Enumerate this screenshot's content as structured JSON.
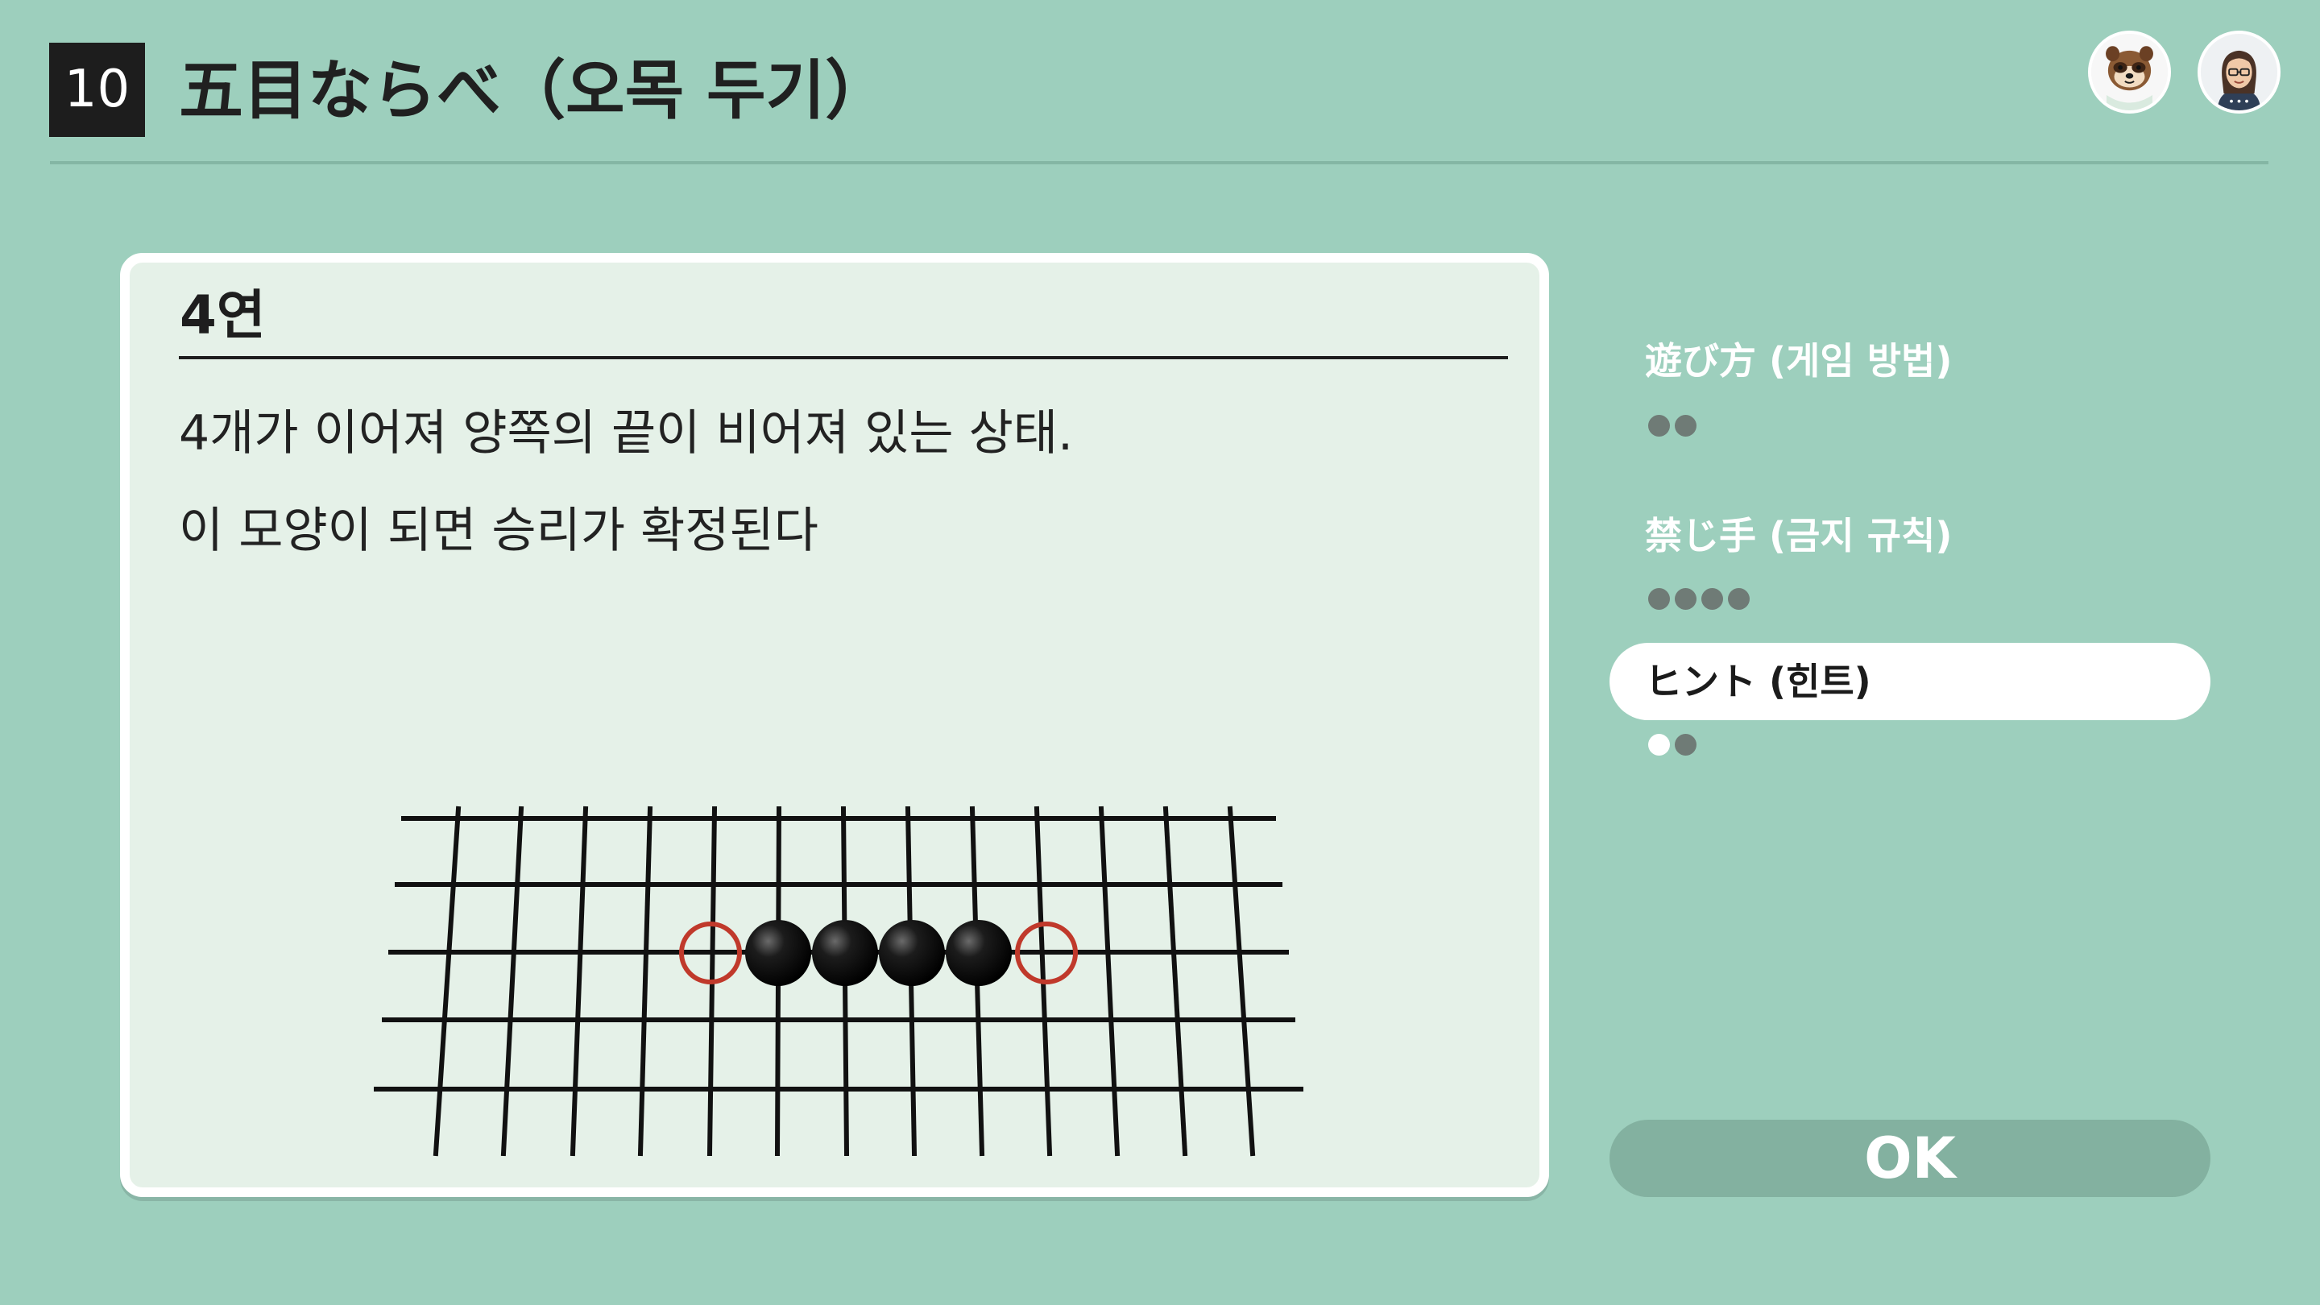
{
  "header": {
    "number": "10",
    "title": "五目ならべ（오목 두기）"
  },
  "card": {
    "title": "4연",
    "description": [
      "4개가 이어져 양쪽의 끝이 비어져 있는 상태.",
      "이 모양이 되면 승리가 확정된다"
    ]
  },
  "menu": {
    "items": [
      {
        "label": "遊び方 (게임 방법)",
        "dots": 2,
        "dots_highlight": 0,
        "selected": false
      },
      {
        "label": "禁じ手 (금지 규칙)",
        "dots": 4,
        "dots_highlight": 0,
        "selected": false
      },
      {
        "label": "ヒント (힌트)",
        "dots": 2,
        "dots_highlight": 1,
        "selected": true
      }
    ]
  },
  "ok_button": {
    "label": "OK"
  },
  "board_diagram": {
    "black_stones": 4,
    "open_ends": 2
  },
  "colors": {
    "background": "#9dcfbd",
    "card": "#e5f1e8",
    "open_end_marker": "#c0392b",
    "stone": "#000000"
  },
  "icons": [
    "raccoon-character-icon",
    "user-avatar-icon"
  ]
}
